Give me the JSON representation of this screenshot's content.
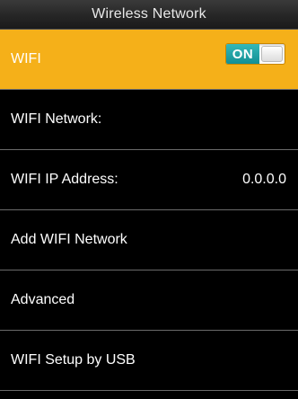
{
  "header": {
    "title": "Wireless Network"
  },
  "menu": {
    "items": [
      {
        "label": "WIFI",
        "toggle": {
          "state": "ON"
        }
      },
      {
        "label": "WIFI Network:"
      },
      {
        "label": "WIFI IP Address:",
        "value": "0.0.0.0"
      },
      {
        "label": "Add WIFI Network"
      },
      {
        "label": "Advanced"
      },
      {
        "label": "WIFI Setup by USB"
      }
    ]
  },
  "colors": {
    "selected_row": "#f5b019",
    "toggle_on": "#1fa3a8",
    "background": "#000000",
    "divider": "#6a6a6a"
  }
}
